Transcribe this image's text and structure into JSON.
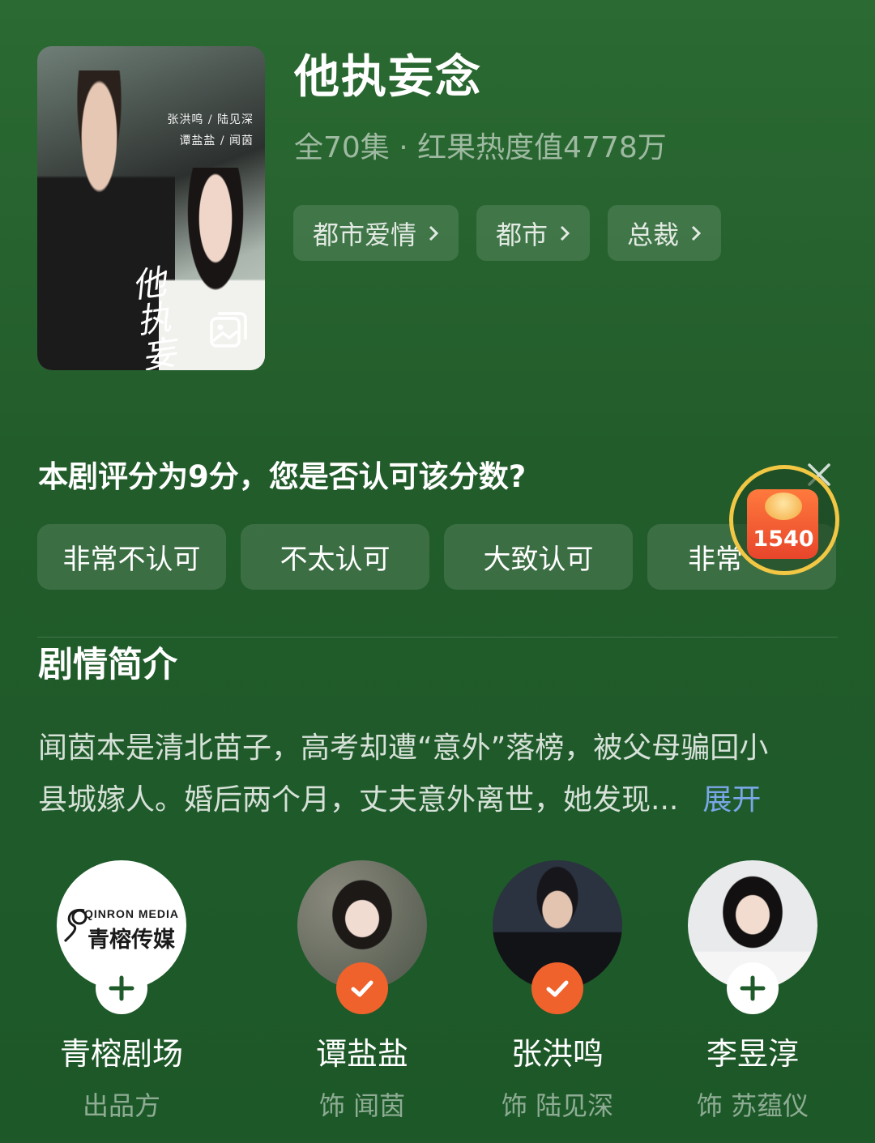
{
  "drama": {
    "title": "他执妄念",
    "meta": "全70集 · 红果热度值4778万",
    "poster": {
      "credit_1": "张洪鸣 / 陆见深",
      "credit_2": "谭盐盐 / 闻茵",
      "calligraphy": "他执妄念"
    },
    "tags": [
      "都市爱情",
      "都市",
      "总裁"
    ]
  },
  "rating": {
    "question": "本剧评分为9分，您是否认可该分数?",
    "options": [
      "非常不认可",
      "不太认可",
      "大致认可",
      "非常"
    ]
  },
  "reward": {
    "count": "1540"
  },
  "synopsis": {
    "title": "剧情简介",
    "line1": "闻茵本是清北苗子，高考却遭“意外”落榜，被父母骗回小",
    "line2": "县城嫁人。婚后两个月，丈夫意外离世，她发现...",
    "expand": "展开"
  },
  "cast": [
    {
      "name": "青榕剧场",
      "role": "出品方",
      "following": false,
      "logo_en": "QINRON MEDIA",
      "logo_cn": "青榕传媒"
    },
    {
      "name": "谭盐盐",
      "role": "饰 闻茵",
      "following": true
    },
    {
      "name": "张洪鸣",
      "role": "饰 陆见深",
      "following": true
    },
    {
      "name": "李昱淳",
      "role": "饰 苏蕴仪",
      "following": false
    }
  ],
  "colors": {
    "background": "#225c2b",
    "accent_orange": "#f0622c",
    "link_blue": "#7aa7e8",
    "reward_ring": "#f2c744"
  }
}
